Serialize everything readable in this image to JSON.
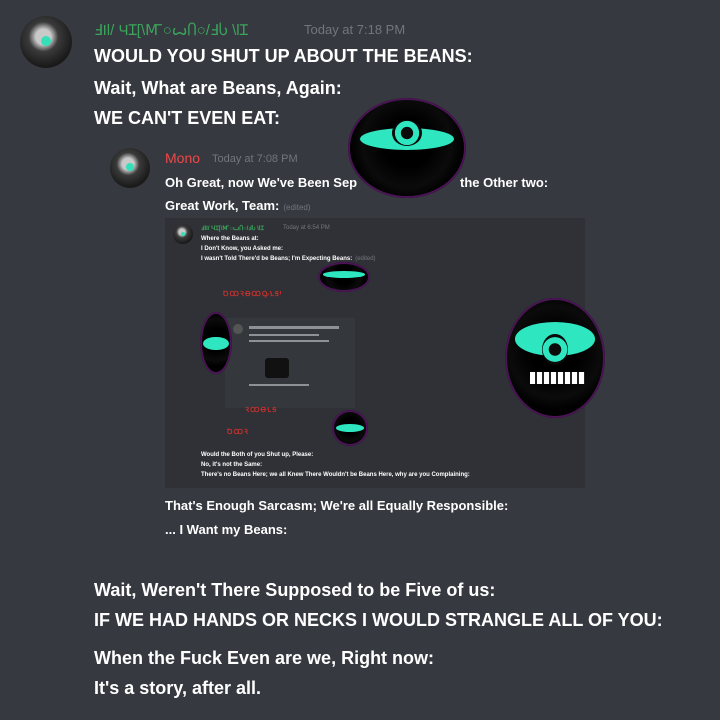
{
  "main_message": {
    "username": "ℲIl/ ЧꞮ[\\Ꙧ○ꙍႶ○/ℲႱ \\lꞮ",
    "timestamp": "Today at 7:18 PM",
    "lines": [
      "WOULD YOU SHUT UP ABOUT THE BEANS:",
      "Wait, What are Beans, Again:",
      "WE CAN'T EVEN EAT:"
    ]
  },
  "quoted_message": {
    "username": "Mono",
    "timestamp": "Today at 7:08 PM",
    "line1_left": "Oh Great, now We've Been Sep",
    "line1_right": "the Other two:",
    "line2": "Great Work, Team:",
    "edited": "(edited)",
    "lines_after": [
      "That's Enough Sarcasm; We're all Equally Responsible:",
      "... I Want my Beans:"
    ]
  },
  "nested_screenshot": {
    "username": "ℲIl/ ЧꞮ[\\Ꙧ○ꙍႶ○/ℲႱ \\lꞮ",
    "timestamp": "Today at 6:54 PM",
    "top_lines": [
      "Where the Beans at:",
      "I Don't Know, you Asked me:",
      "I wasn't Told There'd be Beans; I'm Expecting Beans:"
    ],
    "edited": "(edited)",
    "bottom_lines": [
      "Would the Both of you Shut up, Please:",
      "No, it's not the Same:",
      "There's no Beans Here; we all Knew There Wouldn't be Beans Here, why are you Complaining:"
    ]
  },
  "trailing_lines": [
    "Wait, Weren't There Supposed to be Five of us:",
    "IF WE HAD HANDS OR NECKS I WOULD STRANGLE ALL OF YOU:",
    "When the Fuck Even are we, Right now:",
    "It's a story, after all."
  ],
  "colors": {
    "background": "#36393f",
    "username_green": "#3ba55c",
    "username_red": "#f04747",
    "timestamp": "#72767d",
    "text": "#ffffff",
    "eye_glow": "#2ee6c0"
  }
}
